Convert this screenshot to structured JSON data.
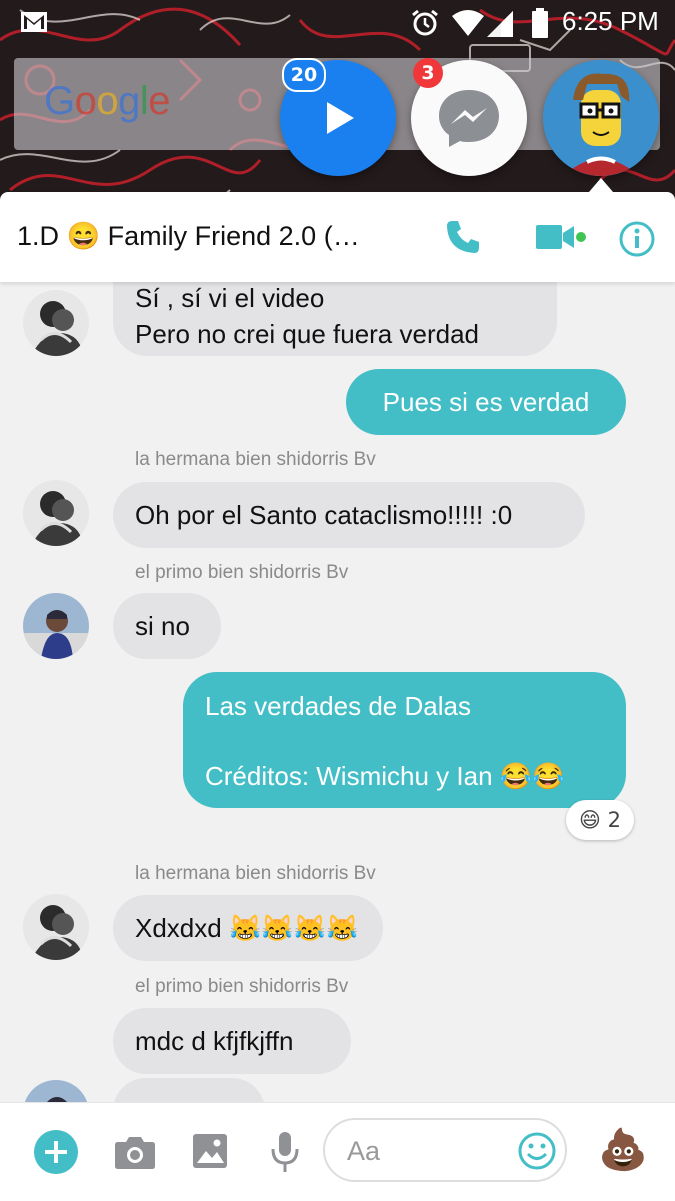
{
  "status_bar": {
    "time": "6:25 PM"
  },
  "google_widget": {
    "logo_text": "Google"
  },
  "chat_heads": {
    "video_badge": "20",
    "messenger_badge": "3"
  },
  "header": {
    "title": "1.D 😄 Family Friend 2.0 (…"
  },
  "messages": [
    {
      "direction": "in",
      "lines": [
        "Sí , sí vi el video",
        "Pero no crei  que fuera verdad"
      ]
    },
    {
      "direction": "out",
      "text": "Pues si es verdad"
    },
    {
      "direction": "in",
      "sender": "la hermana bien shidorris Bv",
      "text": "Oh por el Santo cataclismo!!!!! :0"
    },
    {
      "direction": "in",
      "sender": "el primo bien shidorris Bv",
      "text": "si no"
    },
    {
      "direction": "out",
      "lines": [
        "Las verdades de Dalas",
        "Créditos: Wismichu y Ian 😂😂"
      ],
      "reaction": {
        "emoji": "😄",
        "count": "2"
      }
    },
    {
      "direction": "in",
      "sender": "la hermana bien shidorris Bv",
      "text": "Xdxdxd 😹😹😹😹"
    },
    {
      "direction": "in",
      "sender": "el primo bien shidorris Bv",
      "text": "mdc d kfjfkjffn"
    }
  ],
  "composer": {
    "placeholder": "Aa",
    "like_emoji": "💩"
  },
  "colors": {
    "accent": "#43bec6",
    "messenger_blue": "#1a80f0",
    "badge_red": "#f0383b",
    "incoming_bubble": "#e3e3e5"
  }
}
